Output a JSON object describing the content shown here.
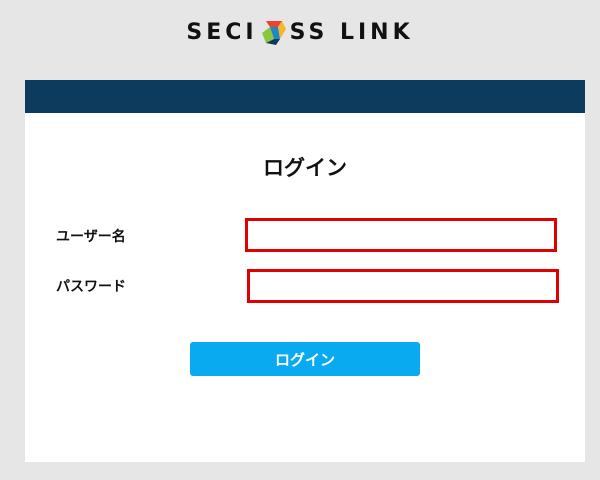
{
  "logo": {
    "text_left": "SECI",
    "text_right": "SS LINK",
    "mark_icon": "seciss-logo-icon",
    "mark_colors": [
      "#e8452c",
      "#8cc63f",
      "#f7b52c",
      "#1e88c7"
    ]
  },
  "header": {
    "color": "#0d3b5e"
  },
  "form": {
    "title": "ログイン",
    "username_label": "ユーザー名",
    "username_value": "",
    "password_label": "パスワード",
    "password_value": "",
    "submit_label": "ログイン",
    "highlight_color": "#e00000",
    "button_color": "#0aaaf0"
  }
}
